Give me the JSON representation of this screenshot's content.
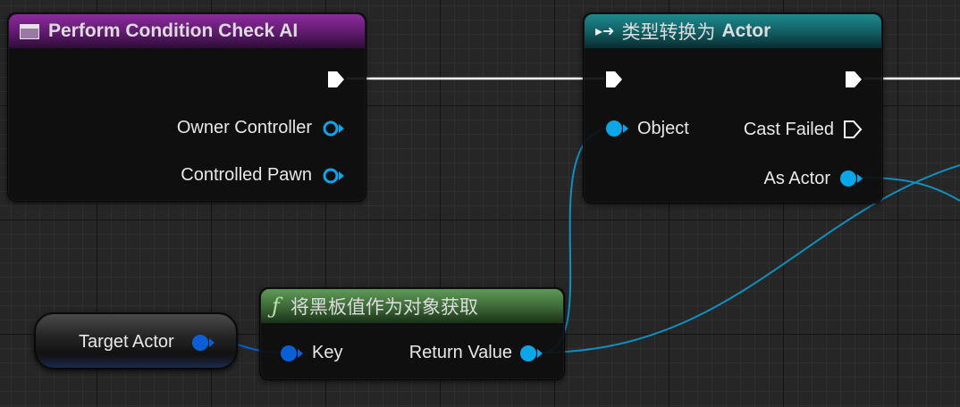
{
  "event_node": {
    "title": "Perform Condition Check AI",
    "pins": {
      "owner_controller": "Owner Controller",
      "controlled_pawn": "Controlled Pawn"
    }
  },
  "cast_node": {
    "title_prefix": "类型转换为",
    "title_target": "Actor",
    "pins": {
      "object": "Object",
      "cast_failed": "Cast Failed",
      "as_actor": "As Actor"
    }
  },
  "function_node": {
    "title": "将黑板值作为对象获取",
    "pins": {
      "key": "Key",
      "return_value": "Return Value"
    }
  },
  "variable_node": {
    "label": "Target Actor"
  },
  "colors": {
    "exec_wire": "#ffffff",
    "object_wire": "#0f8fc0",
    "struct_pin": "#0a5fd6",
    "object_pin": "#0aa6e8",
    "event_header": "#6b1f7a",
    "cast_header": "#166c70",
    "function_header": "#4a7d44"
  }
}
